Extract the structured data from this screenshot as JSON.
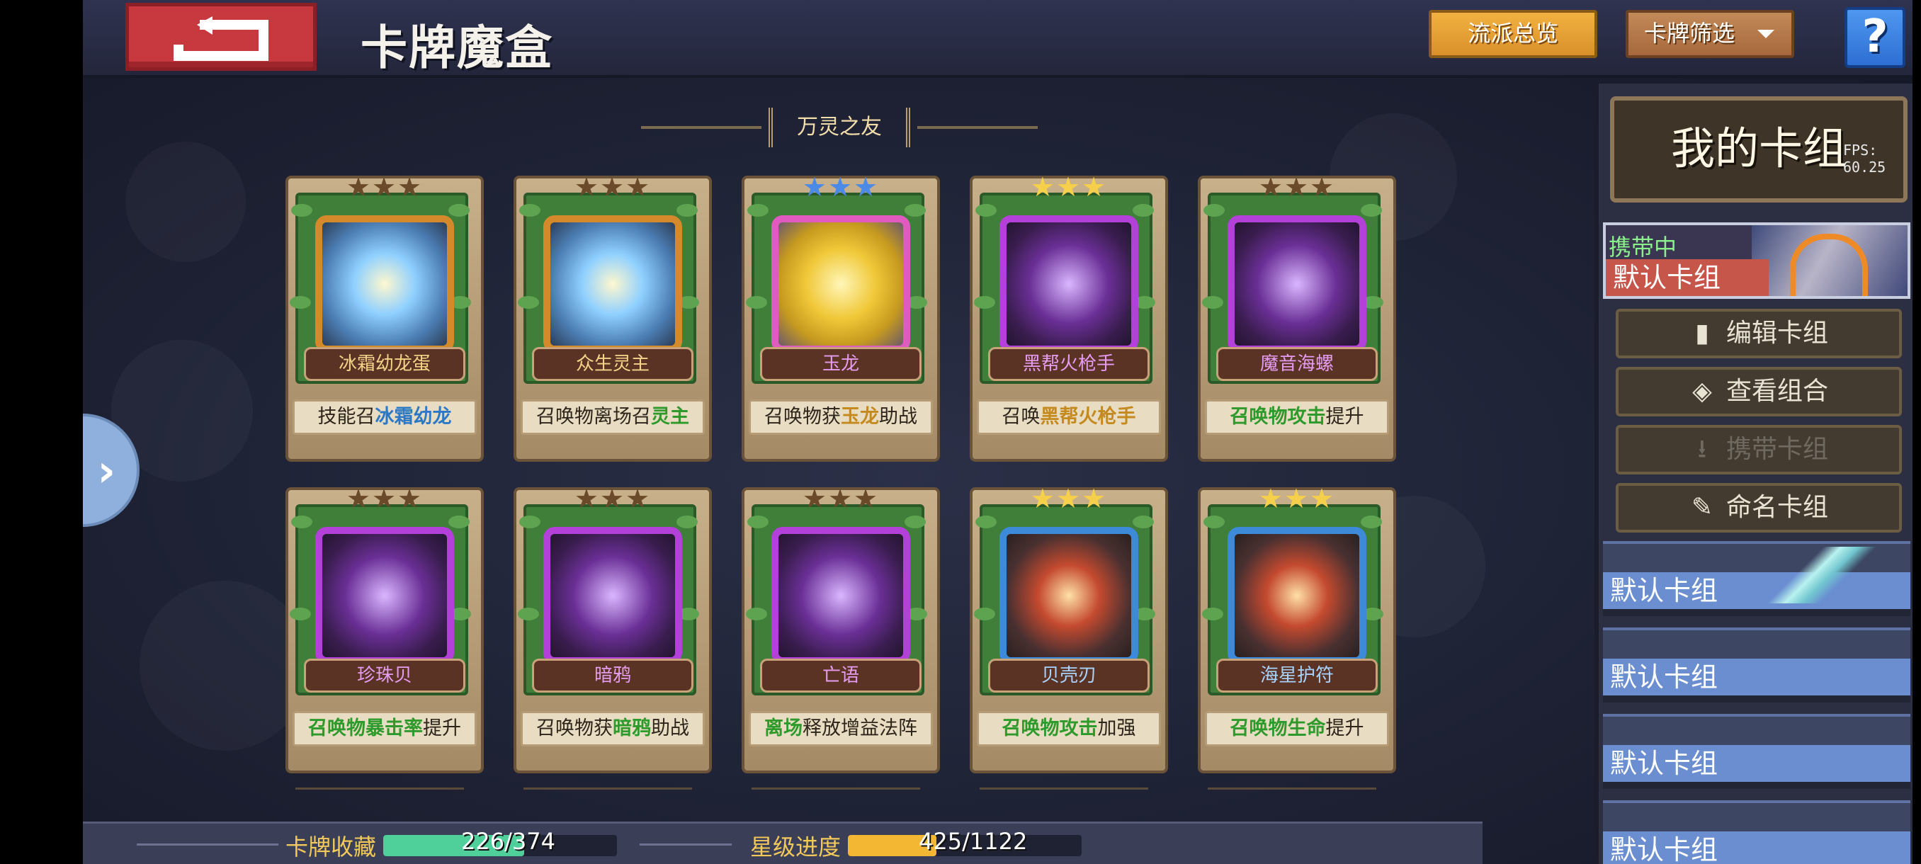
{
  "header": {
    "title": "卡牌魔盒",
    "flow_overview": "流派总览",
    "filter": "卡牌筛选",
    "help": "?"
  },
  "section": {
    "title": "万灵之友"
  },
  "side_tab": {
    "arrow": "›"
  },
  "cards": [
    {
      "name": "冰霜幼龙蛋",
      "stars": "★★★",
      "desc": [
        "技能召",
        "冰霜幼龙"
      ],
      "frame": "gold"
    },
    {
      "name": "众生灵主",
      "stars": "★★★",
      "desc": [
        "召唤物离场召",
        "灵主"
      ],
      "frame": "gold"
    },
    {
      "name": "玉龙",
      "stars": "★★★",
      "desc": [
        "召唤物获",
        "玉龙",
        "助战"
      ],
      "frame": "rainbow"
    },
    {
      "name": "黑帮火枪手",
      "stars": "★★★",
      "desc": [
        "召唤",
        "黑帮火枪手"
      ],
      "frame": "purple"
    },
    {
      "name": "魔音海螺",
      "stars": "★★★",
      "desc": [
        "召唤物",
        "攻击",
        "提升"
      ],
      "frame": "purple"
    },
    {
      "name": "珍珠贝",
      "stars": "★★★",
      "desc": [
        "召唤物",
        "暴击率",
        "提升"
      ],
      "frame": "purple"
    },
    {
      "name": "暗鸦",
      "stars": "★★★",
      "desc": [
        "召唤物获",
        "暗鸦",
        "助战"
      ],
      "frame": "purple"
    },
    {
      "name": "亡语",
      "stars": "★★★",
      "desc": [
        "离场",
        "释放增益法阵"
      ],
      "frame": "purple"
    },
    {
      "name": "贝壳刃",
      "stars": "★★★",
      "desc": [
        "召唤物",
        "攻击",
        "加强"
      ],
      "frame": "blue"
    },
    {
      "name": "海星护符",
      "stars": "★★★",
      "desc": [
        "召唤物",
        "生命",
        "提升"
      ],
      "frame": "blue"
    }
  ],
  "progress": {
    "collection_label": "卡牌收藏",
    "collection_value": "226/374",
    "collection_fraction": 0.604,
    "star_label": "星级进度",
    "star_value": "425/1122",
    "star_fraction": 0.379
  },
  "deck_panel": {
    "title": "我的卡组",
    "fps": "FPS: 60.25",
    "active_status": "携带中",
    "active_name": "默认卡组",
    "actions": {
      "edit": "编辑卡组",
      "view": "查看组合",
      "carry": "携带卡组",
      "rename": "命名卡组"
    },
    "decks": [
      "默认卡组",
      "默认卡组",
      "默认卡组",
      "默认卡组"
    ]
  },
  "colors": {
    "accent_orange": "#f2b241",
    "deck_blue": "#6a8ed0",
    "active_red": "#c6564a",
    "collection_fill": "#4fcf9a",
    "star_fill": "#f3b733"
  }
}
